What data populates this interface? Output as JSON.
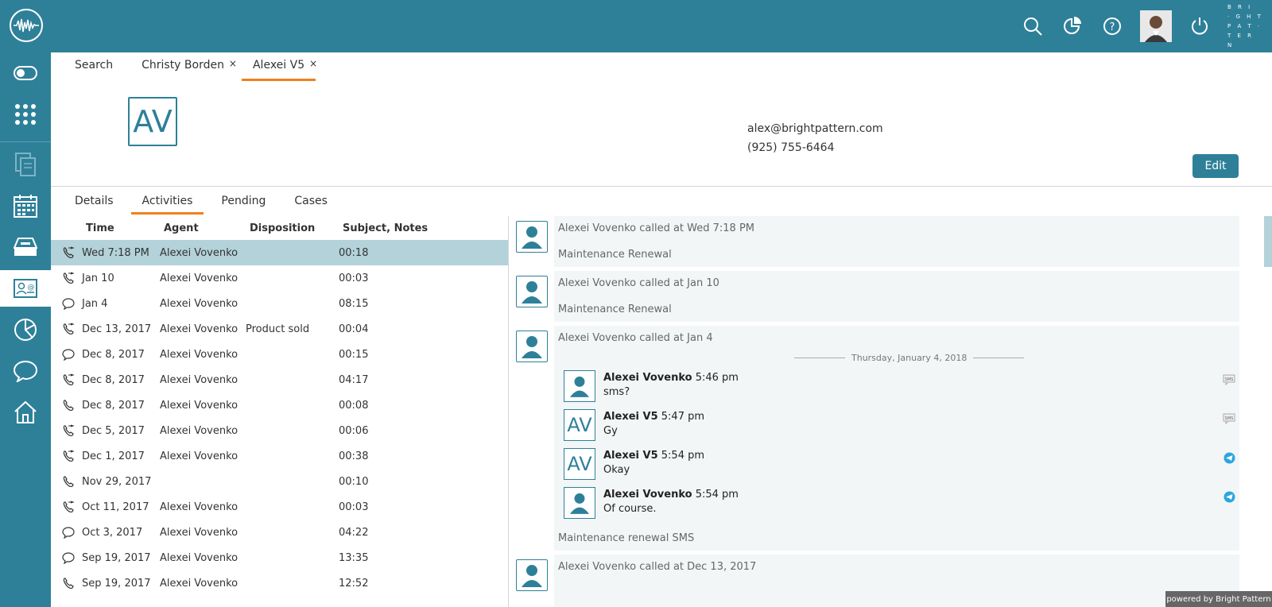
{
  "topbar": {
    "brand_lines": [
      "B R I",
      "· G H T",
      "P A T ·",
      "T E R N"
    ]
  },
  "top_tabs": [
    {
      "label": "Search"
    },
    {
      "label": "Christy Borden",
      "close": "×"
    },
    {
      "label": "Alexei V5",
      "close": "×"
    }
  ],
  "contact": {
    "initials": "AV",
    "email": "alex@brightpattern.com",
    "phone": "(925) 755-6464",
    "edit_label": "Edit"
  },
  "sub_tabs": [
    "Details",
    "Activities",
    "Pending",
    "Cases"
  ],
  "list": {
    "headers": {
      "time": "Time",
      "agent": "Agent",
      "disposition": "Disposition",
      "subject": "Subject, Notes"
    },
    "rows": [
      {
        "icon": "call-icon",
        "time": "Wed 7:18 PM",
        "agent": "Alexei Vovenko",
        "disposition": "",
        "subject": "00:18"
      },
      {
        "icon": "call-icon",
        "time": "Jan 10",
        "agent": "Alexei Vovenko",
        "disposition": "",
        "subject": "00:03"
      },
      {
        "icon": "chat-icon",
        "time": "Jan 4",
        "agent": "Alexei Vovenko",
        "disposition": "",
        "subject": "08:15"
      },
      {
        "icon": "call-icon",
        "time": "Dec 13, 2017",
        "agent": "Alexei Vovenko",
        "disposition": "Product sold",
        "subject": "00:04"
      },
      {
        "icon": "chat-icon",
        "time": "Dec 8, 2017",
        "agent": "Alexei Vovenko",
        "disposition": "",
        "subject": "00:15"
      },
      {
        "icon": "call-icon",
        "time": "Dec 8, 2017",
        "agent": "Alexei Vovenko",
        "disposition": "",
        "subject": "04:17"
      },
      {
        "icon": "phone-icon",
        "time": "Dec 8, 2017",
        "agent": "Alexei Vovenko",
        "disposition": "",
        "subject": "00:08"
      },
      {
        "icon": "call-icon",
        "time": "Dec 5, 2017",
        "agent": "Alexei Vovenko",
        "disposition": "",
        "subject": "00:06"
      },
      {
        "icon": "call-icon",
        "time": "Dec 1, 2017",
        "agent": "Alexei Vovenko",
        "disposition": "",
        "subject": "00:38"
      },
      {
        "icon": "phone-icon",
        "time": "Nov 29, 2017",
        "agent": "",
        "disposition": "",
        "subject": "00:10"
      },
      {
        "icon": "call-icon",
        "time": "Oct 11, 2017",
        "agent": "Alexei Vovenko",
        "disposition": "",
        "subject": "00:03"
      },
      {
        "icon": "chat-icon",
        "time": "Oct 3, 2017",
        "agent": "Alexei Vovenko",
        "disposition": "",
        "subject": "04:22"
      },
      {
        "icon": "chat-icon",
        "time": "Sep 19, 2017",
        "agent": "Alexei Vovenko",
        "disposition": "",
        "subject": "13:35"
      },
      {
        "icon": "phone-icon",
        "time": "Sep 19, 2017",
        "agent": "Alexei Vovenko",
        "disposition": "",
        "subject": "12:52"
      }
    ]
  },
  "activities": [
    {
      "title": "Alexei Vovenko called at Wed 7:18 PM",
      "subject": "Maintenance Renewal"
    },
    {
      "title": "Alexei Vovenko called at Jan 10",
      "subject": "Maintenance Renewal"
    },
    {
      "title": "Alexei Vovenko called at Jan 4",
      "date_separator": "Thursday, January 4, 2018",
      "messages": [
        {
          "sender": "Alexei Vovenko",
          "time": "5:46 pm",
          "text": "sms?",
          "avatar": "person",
          "channel": "sms-icon",
          "channel_label": "SMS"
        },
        {
          "sender": "Alexei V5",
          "time": "5:47 pm",
          "text": "Gy",
          "avatar": "AV",
          "channel": "sms-icon",
          "channel_label": "SMS"
        },
        {
          "sender": "Alexei V5",
          "time": "5:54 pm",
          "text": "Okay",
          "avatar": "AV",
          "channel": "telegram-icon"
        },
        {
          "sender": "Alexei Vovenko",
          "time": "5:54 pm",
          "text": "Of course.",
          "avatar": "person",
          "channel": "telegram-icon"
        }
      ],
      "subject": "Maintenance renewal SMS"
    },
    {
      "title": "Alexei Vovenko called at Dec 13, 2017"
    }
  ],
  "footer": {
    "powered": "powered by Bright Pattern"
  },
  "colors": {
    "brand": "#2e8099",
    "accent": "#f0801e",
    "selected_row": "#b3d2d9"
  }
}
